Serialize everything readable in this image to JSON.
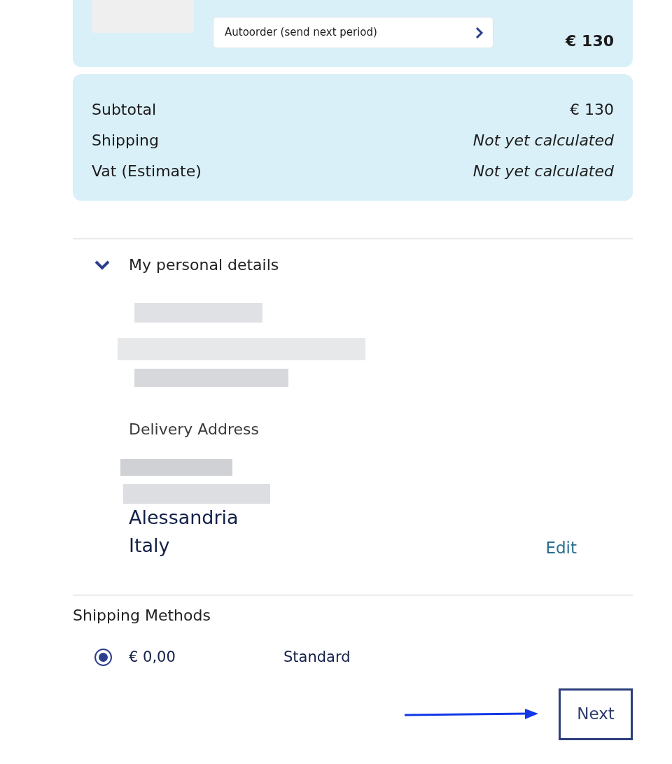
{
  "product": {
    "option": "Autoorder (send next period)",
    "price": "€ 130"
  },
  "summary": [
    {
      "label": "Subtotal",
      "value": "€ 130",
      "kind": "amount"
    },
    {
      "label": "Shipping",
      "value": "Not yet calculated",
      "kind": "pending"
    },
    {
      "label": "Vat (Estimate)",
      "value": "Not yet calculated",
      "kind": "pending"
    }
  ],
  "personal_details": {
    "title": "My personal details",
    "expanded": true,
    "delivery_heading": "Delivery Address",
    "address_lines": [
      "Alessandria",
      "Italy"
    ],
    "edit_link": "Edit"
  },
  "shipping": {
    "title": "Shipping Methods",
    "options": [
      {
        "price": "€ 0,00",
        "name": "Standard",
        "selected": true
      }
    ]
  },
  "next_button": "Next"
}
